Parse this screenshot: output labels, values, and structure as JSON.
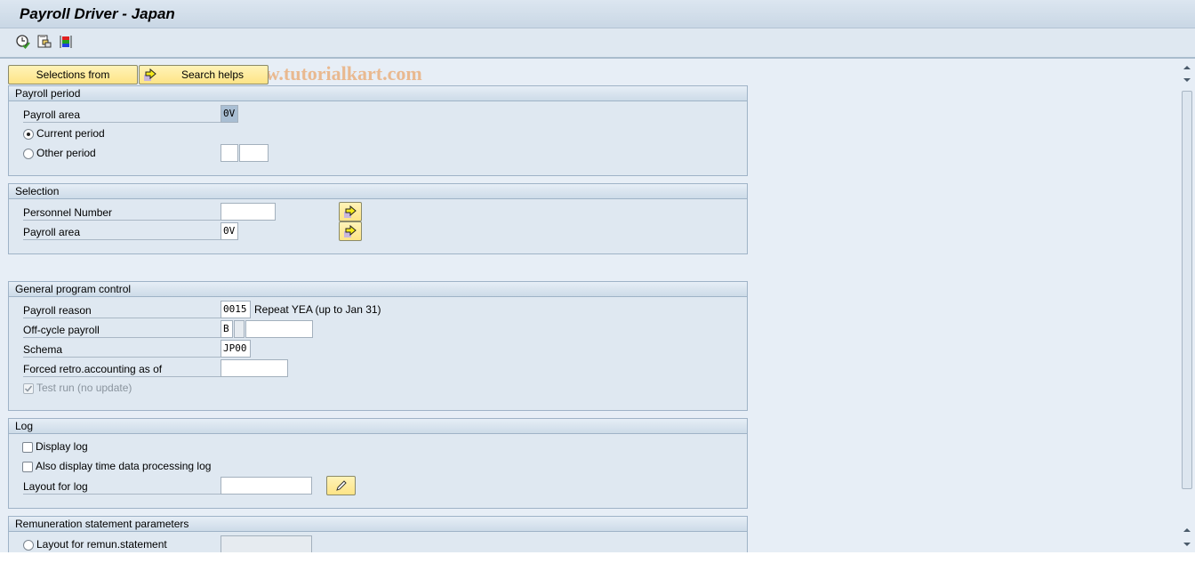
{
  "window": {
    "title": "Payroll Driver - Japan"
  },
  "toolbar": {
    "icons": [
      "execute-icon",
      "get-variant-icon",
      "selection-options-icon"
    ],
    "watermark": "© www.tutorialkart.com"
  },
  "actions": {
    "selections_from": "Selections from",
    "search_helps": "Search helps"
  },
  "payroll_period": {
    "title": "Payroll period",
    "payroll_area_label": "Payroll area",
    "payroll_area_value": "0V",
    "current_period_label": "Current period",
    "current_period_selected": true,
    "other_period_label": "Other period",
    "other_period_selected": false,
    "other_period_value1": "",
    "other_period_value2": ""
  },
  "selection": {
    "title": "Selection",
    "personnel_number_label": "Personnel Number",
    "personnel_number_value": "",
    "payroll_area_label": "Payroll area",
    "payroll_area_value": "0V"
  },
  "general": {
    "title": "General program control",
    "payroll_reason_label": "Payroll reason",
    "payroll_reason_value": "0015",
    "payroll_reason_text": "Repeat YEA (up to Jan 31)",
    "offcycle_label": "Off-cycle payroll",
    "offcycle_value1": "B",
    "offcycle_value2": "",
    "offcycle_value3": "",
    "schema_label": "Schema",
    "schema_value": "JP00",
    "forced_retro_label": "Forced retro.accounting as of",
    "forced_retro_value": "",
    "test_run_label": "Test run (no update)",
    "test_run_checked": true
  },
  "log": {
    "title": "Log",
    "display_log_label": "Display log",
    "time_data_log_label": "Also display time data processing log",
    "layout_label": "Layout for log",
    "layout_value": ""
  },
  "remuneration": {
    "title": "Remuneration statement parameters",
    "layout_label": "Layout for remun.statement",
    "layout_value": ""
  }
}
